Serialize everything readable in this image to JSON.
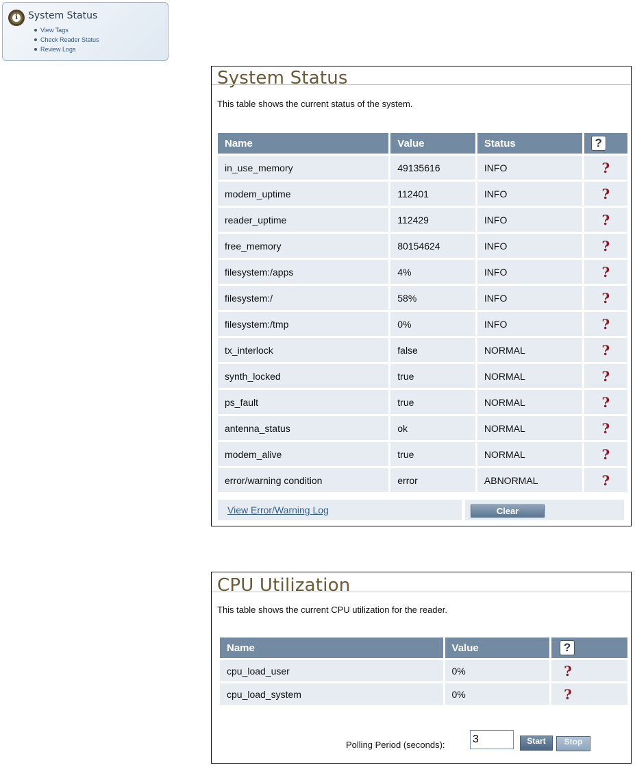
{
  "nav": {
    "icon": "info-icon",
    "title": "System Status",
    "links": [
      "View Tags",
      "Check Reader Status",
      "Review Logs"
    ]
  },
  "system_status": {
    "title": "System Status",
    "description": "This table shows the current status of the system.",
    "headers": {
      "name": "Name",
      "value": "Value",
      "status": "Status",
      "help": "?"
    },
    "rows": [
      {
        "name": "in_use_memory",
        "value": "49135616",
        "status": "INFO"
      },
      {
        "name": "modem_uptime",
        "value": "112401",
        "status": "INFO"
      },
      {
        "name": "reader_uptime",
        "value": "112429",
        "status": "INFO"
      },
      {
        "name": "free_memory",
        "value": "80154624",
        "status": "INFO"
      },
      {
        "name": "filesystem:/apps",
        "value": "4%",
        "status": "INFO"
      },
      {
        "name": "filesystem:/",
        "value": "58%",
        "status": "INFO"
      },
      {
        "name": "filesystem:/tmp",
        "value": "0%",
        "status": "INFO"
      },
      {
        "name": "tx_interlock",
        "value": "false",
        "status": "NORMAL"
      },
      {
        "name": "synth_locked",
        "value": "true",
        "status": "NORMAL"
      },
      {
        "name": "ps_fault",
        "value": "true",
        "status": "NORMAL"
      },
      {
        "name": "antenna_status",
        "value": "ok",
        "status": "NORMAL"
      },
      {
        "name": "modem_alive",
        "value": "true",
        "status": "NORMAL"
      },
      {
        "name": "error/warning condition",
        "value": "error",
        "status": "ABNORMAL"
      }
    ],
    "help_glyph": "?",
    "log_link": "View Error/Warning Log",
    "clear_button": "Clear"
  },
  "cpu": {
    "title": "CPU Utilization",
    "description": "This table shows the current CPU utilization for the reader.",
    "headers": {
      "name": "Name",
      "value": "Value",
      "help": "?"
    },
    "rows": [
      {
        "name": "cpu_load_user",
        "value": "0%"
      },
      {
        "name": "cpu_load_system",
        "value": "0%"
      }
    ],
    "help_glyph": "?",
    "polling_label": "Polling Period (seconds):",
    "polling_value": "3",
    "start_button": "Start",
    "stop_button": "Stop"
  },
  "colors": {
    "header_bg": "#728ba3",
    "row_bg": "#e6ecf2",
    "normal": "#1f9a2e",
    "abnormal": "#a6141d",
    "title": "#6b5a35"
  }
}
